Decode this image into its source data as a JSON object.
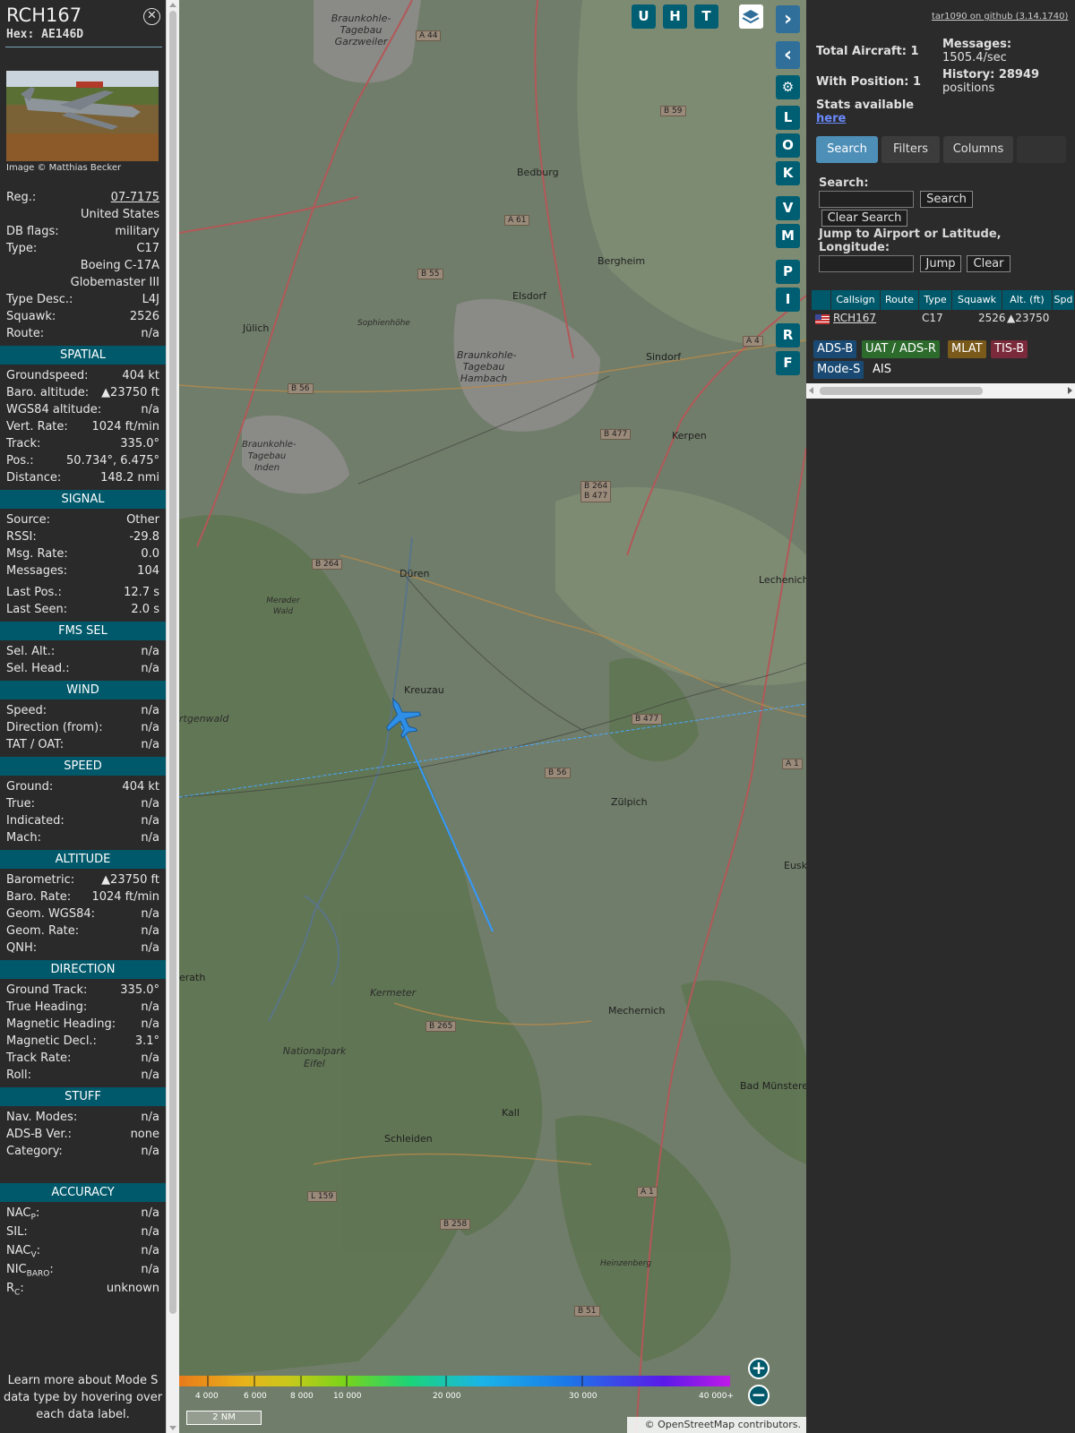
{
  "aircraft": {
    "callsign": "RCH167",
    "hex": "Hex: AE146D",
    "photo_credit": "Image © Matthias Becker",
    "details": [
      {
        "label": "Reg.:",
        "value": "07-7175"
      },
      {
        "label": "",
        "value": "United States"
      },
      {
        "label": "DB flags:",
        "value": "military"
      },
      {
        "label": "Type:",
        "value": "C17"
      },
      {
        "label": "",
        "value": "Boeing C-17A"
      },
      {
        "label": "",
        "value": "Globemaster III"
      },
      {
        "label": "Type Desc.:",
        "value": "L4J"
      },
      {
        "label": "Squawk:",
        "value": "2526"
      },
      {
        "label": "Route:",
        "value": "n/a"
      }
    ],
    "sections": [
      {
        "title": "SPATIAL",
        "rows": [
          {
            "label": "Groundspeed:",
            "value": "404 kt"
          },
          {
            "label": "Baro. altitude:",
            "value": "▲23750 ft"
          },
          {
            "label": "WGS84 altitude:",
            "value": "n/a"
          },
          {
            "label": "Vert. Rate:",
            "value": "1024 ft/min"
          },
          {
            "label": "Track:",
            "value": "335.0°"
          },
          {
            "label": "Pos.:",
            "value": "50.734°, 6.475°"
          },
          {
            "label": "Distance:",
            "value": "148.2 nmi"
          }
        ]
      },
      {
        "title": "SIGNAL",
        "rows": [
          {
            "label": "Source:",
            "value": "Other"
          },
          {
            "label": "RSSI:",
            "value": "-29.8"
          },
          {
            "label": "Msg. Rate:",
            "value": "0.0"
          },
          {
            "label": "Messages:",
            "value": "104"
          },
          {
            "label": "Last Pos.:",
            "value": "12.7 s"
          },
          {
            "label": "Last Seen:",
            "value": "2.0 s"
          }
        ]
      },
      {
        "title": "FMS SEL",
        "rows": [
          {
            "label": "Sel. Alt.:",
            "value": "n/a"
          },
          {
            "label": "Sel. Head.:",
            "value": "n/a"
          }
        ]
      },
      {
        "title": "WIND",
        "rows": [
          {
            "label": "Speed:",
            "value": "n/a"
          },
          {
            "label": "Direction (from):",
            "value": "n/a"
          },
          {
            "label": "TAT / OAT:",
            "value": "n/a"
          }
        ]
      },
      {
        "title": "SPEED",
        "rows": [
          {
            "label": "Ground:",
            "value": "404 kt"
          },
          {
            "label": "True:",
            "value": "n/a"
          },
          {
            "label": "Indicated:",
            "value": "n/a"
          },
          {
            "label": "Mach:",
            "value": "n/a"
          }
        ]
      },
      {
        "title": "ALTITUDE",
        "rows": [
          {
            "label": "Barometric:",
            "value": "▲23750 ft"
          },
          {
            "label": "Baro. Rate:",
            "value": "1024 ft/min"
          },
          {
            "label": "Geom. WGS84:",
            "value": "n/a"
          },
          {
            "label": "Geom. Rate:",
            "value": "n/a"
          },
          {
            "label": "QNH:",
            "value": "n/a"
          }
        ]
      },
      {
        "title": "DIRECTION",
        "rows": [
          {
            "label": "Ground Track:",
            "value": "335.0°"
          },
          {
            "label": "True Heading:",
            "value": "n/a"
          },
          {
            "label": "Magnetic Heading:",
            "value": "n/a"
          },
          {
            "label": "Magnetic Decl.:",
            "value": "3.1°"
          },
          {
            "label": "Track Rate:",
            "value": "n/a"
          },
          {
            "label": "Roll:",
            "value": "n/a"
          }
        ]
      },
      {
        "title": "STUFF",
        "rows": [
          {
            "label": "Nav. Modes:",
            "value": "n/a"
          },
          {
            "label": "ADS-B Ver.:",
            "value": "none"
          },
          {
            "label": "Category:",
            "value": "n/a"
          }
        ]
      },
      {
        "title": "ACCURACY",
        "rows": [
          {
            "label": "NAC",
            "sub": "P",
            "suffix": ":",
            "value": "n/a"
          },
          {
            "label": "SIL:",
            "value": "n/a"
          },
          {
            "label": "NAC",
            "sub": "V",
            "suffix": ":",
            "value": "n/a"
          },
          {
            "label": "NIC",
            "sub": "BARO",
            "suffix": ":",
            "value": "n/a"
          },
          {
            "label": "R",
            "sub": "C",
            "suffix": ":",
            "value": "unknown"
          }
        ]
      }
    ],
    "learn_more": "Learn more about Mode S data type by hovering over each data label."
  },
  "map": {
    "buttons_top": [
      "U",
      "H",
      "T"
    ],
    "buttons_side": [
      "L",
      "O",
      "K",
      "V",
      "M",
      "P",
      "I",
      "R",
      "F"
    ],
    "places": [
      "Braunkohle-Tagebau Garzweiler",
      "Bedburg",
      "Bergheim",
      "Elsdorf",
      "Jülich",
      "Sophienhöhe",
      "Braunkohle-Tagebau Hambach",
      "Sindorf",
      "Kerpen",
      "Braunkohle-Tagebau Inden",
      "Düren",
      "Lechenich",
      "Merøder Wald",
      "Kreuzau",
      "Zülpich",
      "rtgenwald",
      "Kermeter",
      "Nationalpark Eifel",
      "Mechernich",
      "Kall",
      "Schleiden",
      "Bad Münsterei",
      "Eusk",
      "erath",
      "Heinzenberg"
    ],
    "roads": [
      "A 44",
      "B 59",
      "A 61",
      "B 55",
      "A 4",
      "B 56",
      "B 477",
      "B 264",
      "B 477",
      "B 264",
      "B 477",
      "B 56",
      "A 1",
      "B 265",
      "L 159",
      "B 258",
      "A 1",
      "B 51"
    ],
    "legend": [
      "4 000",
      "6 000",
      "8 000",
      "10 000",
      "20 000",
      "30 000",
      "40 000+"
    ],
    "scale": "2 NM",
    "attribution": "© OpenStreetMap contributors."
  },
  "panel": {
    "github": "tar1090 on github (3.14.1740)",
    "total_aircraft": "Total Aircraft: 1",
    "with_position": "With Position: 1",
    "messages_label": "Messages:",
    "messages_value": "1505.4/sec",
    "history_label": "History: 28949",
    "history_value": "positions",
    "stats_label": "Stats available",
    "stats_link": "here",
    "tabs": [
      "Search",
      "Filters",
      "Columns"
    ],
    "search_label": "Search:",
    "search_btn": "Search",
    "clear_search_btn": "Clear Search",
    "jump_label": "Jump to Airport or Latitude, Longitude:",
    "jump_btn": "Jump",
    "clear_btn": "Clear",
    "columns": [
      "",
      "Callsign",
      "Route",
      "Type",
      "Squawk",
      "Alt. (ft)",
      "Spd"
    ],
    "row": {
      "callsign": "RCH167",
      "route": "",
      "type": "C17",
      "squawk": "2526",
      "alt": "▲23750"
    },
    "sources": [
      "ADS-B",
      "UAT / ADS-R",
      "MLAT",
      "TIS-B",
      "Mode-S",
      "AIS"
    ],
    "colors": {
      "adsb": "#1a4a73",
      "uat": "#2d6b2d",
      "mlat": "#7a5a1a",
      "tisb": "#7a2a3a",
      "modes": "#1a4a73",
      "accent": "#00596b"
    }
  }
}
